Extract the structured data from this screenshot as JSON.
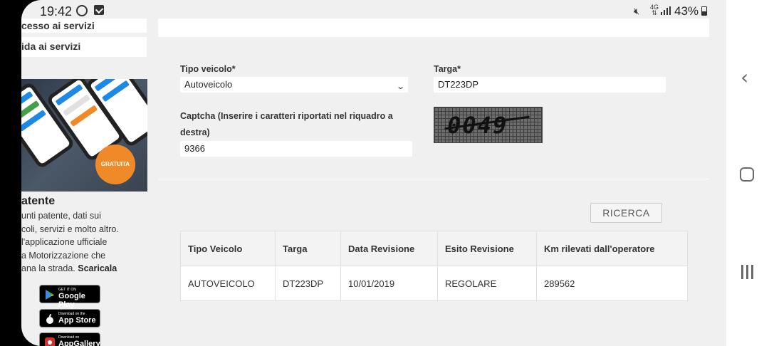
{
  "status_bar": {
    "time": "19:42",
    "battery": "43%",
    "network": "4G"
  },
  "sidebar": {
    "links": [
      "cesso ai servizi",
      "ida ai servizi"
    ],
    "promo_badge": "GRATUITA",
    "app_title": "atente",
    "app_desc_lines": [
      "unti patente, dati sui",
      "coli, servizi e molto altro.",
      " l'applicazione ufficiale",
      "a Motorizzazione che",
      "ana la strada."
    ],
    "app_desc_cta": "Scaricala",
    "stores": [
      {
        "small": "GET IT ON",
        "big": "Google Play",
        "icon": "google-play-icon"
      },
      {
        "small": "Download on the",
        "big": "App Store",
        "icon": "apple-icon"
      },
      {
        "small": "Download on",
        "big": "AppGallery",
        "icon": "huawei-icon"
      }
    ]
  },
  "form": {
    "vehicle_type_label": "Tipo veicolo*",
    "vehicle_type_value": "Autoveicolo",
    "plate_label": "Targa*",
    "plate_value": "DT223DP",
    "captcha_label_1": "Captcha (Inserire i caratteri riportati nel riquadro a",
    "captcha_label_2": "destra)",
    "captcha_value": "9366",
    "captcha_image_text": "0049",
    "search_button": "RICERCA"
  },
  "results": {
    "headers": [
      "Tipo Veicolo",
      "Targa",
      "Data Revisione",
      "Esito Revisione",
      "Km rilevati dall'operatore"
    ],
    "rows": [
      [
        "AUTOVEICOLO",
        "DT223DP",
        "10/01/2019",
        "REGOLARE",
        "289562"
      ]
    ]
  }
}
